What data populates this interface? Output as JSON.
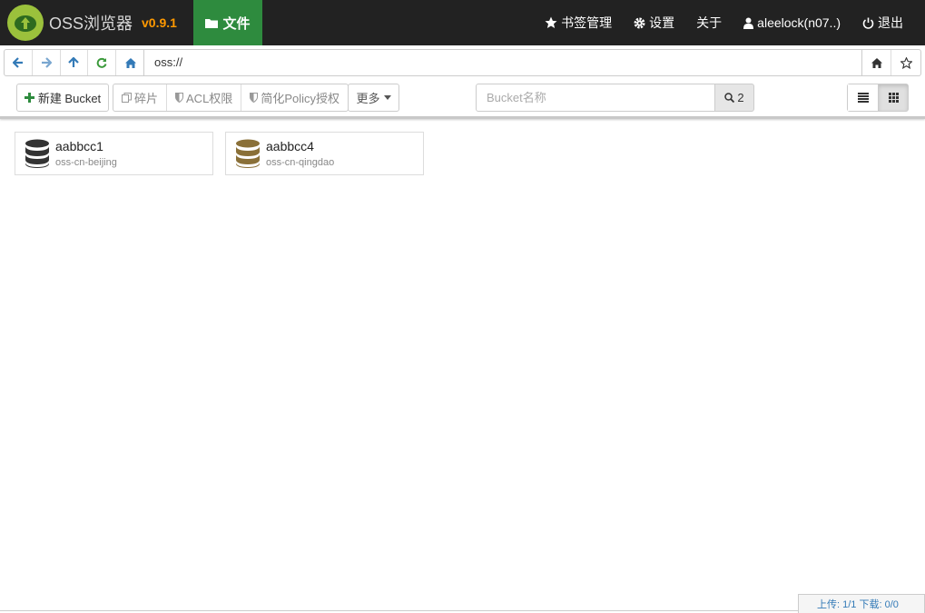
{
  "app": {
    "name": "OSS浏览器",
    "version": "v0.9.1"
  },
  "nav": {
    "files_label": "文件",
    "bookmarks_label": "书签管理",
    "settings_label": "设置",
    "about_label": "关于",
    "user_label": "aleelock(n07..)",
    "logout_label": "退出"
  },
  "address": {
    "value": "oss://"
  },
  "toolbar": {
    "new_bucket_label": "新建 Bucket",
    "fragments_label": "碎片",
    "acl_label": "ACL权限",
    "policy_label": "简化Policy授权",
    "more_label": "更多",
    "search_placeholder": "Bucket名称",
    "search_count": "2"
  },
  "buckets": [
    {
      "name": "aabbcc1",
      "region": "oss-cn-beijing",
      "color": "#333333"
    },
    {
      "name": "aabbcc4",
      "region": "oss-cn-qingdao",
      "color": "#8a7038"
    }
  ],
  "status": {
    "text": "上传: 1/1 下载: 0/0"
  },
  "colors": {
    "navbar_bg": "#222222",
    "active_tab": "#2e8b3e",
    "version": "#ff9900",
    "logo": "#9bc13c"
  }
}
